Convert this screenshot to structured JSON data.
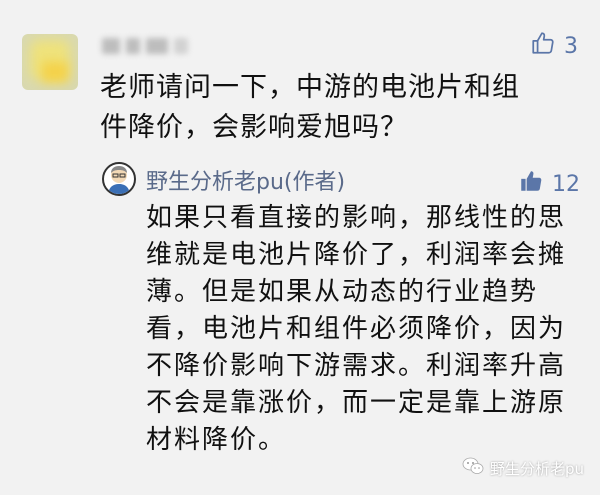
{
  "comment": {
    "author_blurred": true,
    "likes": "3",
    "text": "老师请问一下，中游的电池片和组件降价，会影响爱旭吗？"
  },
  "reply": {
    "author": "野生分析老pu(作者)",
    "likes": "12",
    "text": "如果只看直接的影响，那线性的思维就是电池片降价了，利润率会摊薄。但是如果从动态的行业趋势看，电池片和组件必须降价，因为不降价影响下游需求。利润率升高不会是靠涨价，而一定是靠上游原材料降价。"
  },
  "watermark": {
    "label": "野生分析老pu"
  },
  "colors": {
    "background": "#f2f2f2",
    "like_outline": "#5b76a8",
    "like_filled": "#5b76a8",
    "author_name": "#5a6a8a"
  },
  "icons": {
    "comment_like": "thumbs-up-outline-icon",
    "reply_like": "thumbs-up-filled-icon",
    "watermark": "wechat-icon"
  }
}
